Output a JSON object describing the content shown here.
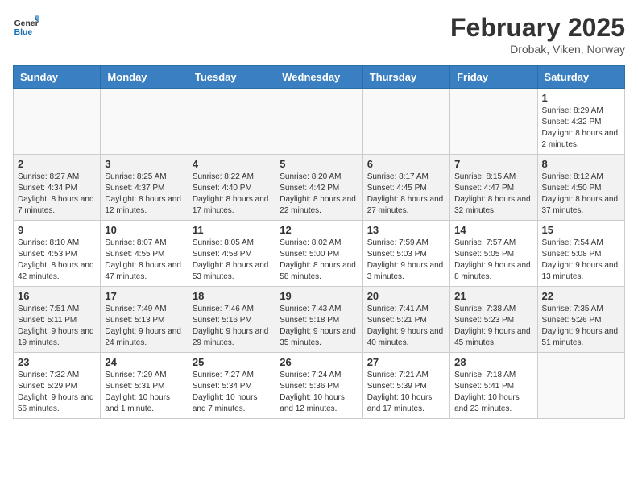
{
  "logo": {
    "general": "General",
    "blue": "Blue"
  },
  "header": {
    "title": "February 2025",
    "subtitle": "Drobak, Viken, Norway"
  },
  "weekdays": [
    "Sunday",
    "Monday",
    "Tuesday",
    "Wednesday",
    "Thursday",
    "Friday",
    "Saturday"
  ],
  "weeks": [
    [
      {
        "day": "",
        "info": ""
      },
      {
        "day": "",
        "info": ""
      },
      {
        "day": "",
        "info": ""
      },
      {
        "day": "",
        "info": ""
      },
      {
        "day": "",
        "info": ""
      },
      {
        "day": "",
        "info": ""
      },
      {
        "day": "1",
        "info": "Sunrise: 8:29 AM\nSunset: 4:32 PM\nDaylight: 8 hours and 2 minutes."
      }
    ],
    [
      {
        "day": "2",
        "info": "Sunrise: 8:27 AM\nSunset: 4:34 PM\nDaylight: 8 hours and 7 minutes."
      },
      {
        "day": "3",
        "info": "Sunrise: 8:25 AM\nSunset: 4:37 PM\nDaylight: 8 hours and 12 minutes."
      },
      {
        "day": "4",
        "info": "Sunrise: 8:22 AM\nSunset: 4:40 PM\nDaylight: 8 hours and 17 minutes."
      },
      {
        "day": "5",
        "info": "Sunrise: 8:20 AM\nSunset: 4:42 PM\nDaylight: 8 hours and 22 minutes."
      },
      {
        "day": "6",
        "info": "Sunrise: 8:17 AM\nSunset: 4:45 PM\nDaylight: 8 hours and 27 minutes."
      },
      {
        "day": "7",
        "info": "Sunrise: 8:15 AM\nSunset: 4:47 PM\nDaylight: 8 hours and 32 minutes."
      },
      {
        "day": "8",
        "info": "Sunrise: 8:12 AM\nSunset: 4:50 PM\nDaylight: 8 hours and 37 minutes."
      }
    ],
    [
      {
        "day": "9",
        "info": "Sunrise: 8:10 AM\nSunset: 4:53 PM\nDaylight: 8 hours and 42 minutes."
      },
      {
        "day": "10",
        "info": "Sunrise: 8:07 AM\nSunset: 4:55 PM\nDaylight: 8 hours and 47 minutes."
      },
      {
        "day": "11",
        "info": "Sunrise: 8:05 AM\nSunset: 4:58 PM\nDaylight: 8 hours and 53 minutes."
      },
      {
        "day": "12",
        "info": "Sunrise: 8:02 AM\nSunset: 5:00 PM\nDaylight: 8 hours and 58 minutes."
      },
      {
        "day": "13",
        "info": "Sunrise: 7:59 AM\nSunset: 5:03 PM\nDaylight: 9 hours and 3 minutes."
      },
      {
        "day": "14",
        "info": "Sunrise: 7:57 AM\nSunset: 5:05 PM\nDaylight: 9 hours and 8 minutes."
      },
      {
        "day": "15",
        "info": "Sunrise: 7:54 AM\nSunset: 5:08 PM\nDaylight: 9 hours and 13 minutes."
      }
    ],
    [
      {
        "day": "16",
        "info": "Sunrise: 7:51 AM\nSunset: 5:11 PM\nDaylight: 9 hours and 19 minutes."
      },
      {
        "day": "17",
        "info": "Sunrise: 7:49 AM\nSunset: 5:13 PM\nDaylight: 9 hours and 24 minutes."
      },
      {
        "day": "18",
        "info": "Sunrise: 7:46 AM\nSunset: 5:16 PM\nDaylight: 9 hours and 29 minutes."
      },
      {
        "day": "19",
        "info": "Sunrise: 7:43 AM\nSunset: 5:18 PM\nDaylight: 9 hours and 35 minutes."
      },
      {
        "day": "20",
        "info": "Sunrise: 7:41 AM\nSunset: 5:21 PM\nDaylight: 9 hours and 40 minutes."
      },
      {
        "day": "21",
        "info": "Sunrise: 7:38 AM\nSunset: 5:23 PM\nDaylight: 9 hours and 45 minutes."
      },
      {
        "day": "22",
        "info": "Sunrise: 7:35 AM\nSunset: 5:26 PM\nDaylight: 9 hours and 51 minutes."
      }
    ],
    [
      {
        "day": "23",
        "info": "Sunrise: 7:32 AM\nSunset: 5:29 PM\nDaylight: 9 hours and 56 minutes."
      },
      {
        "day": "24",
        "info": "Sunrise: 7:29 AM\nSunset: 5:31 PM\nDaylight: 10 hours and 1 minute."
      },
      {
        "day": "25",
        "info": "Sunrise: 7:27 AM\nSunset: 5:34 PM\nDaylight: 10 hours and 7 minutes."
      },
      {
        "day": "26",
        "info": "Sunrise: 7:24 AM\nSunset: 5:36 PM\nDaylight: 10 hours and 12 minutes."
      },
      {
        "day": "27",
        "info": "Sunrise: 7:21 AM\nSunset: 5:39 PM\nDaylight: 10 hours and 17 minutes."
      },
      {
        "day": "28",
        "info": "Sunrise: 7:18 AM\nSunset: 5:41 PM\nDaylight: 10 hours and 23 minutes."
      },
      {
        "day": "",
        "info": ""
      }
    ]
  ]
}
